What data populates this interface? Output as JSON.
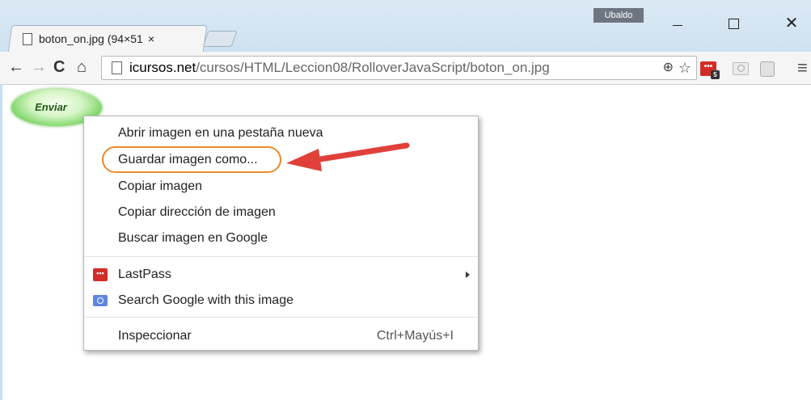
{
  "window": {
    "profile_name": "Ubaldo",
    "close_glyph": "✕"
  },
  "tab": {
    "title": "boton_on.jpg (94×51",
    "close_glyph": "×"
  },
  "toolbar": {
    "back_glyph": "←",
    "forward_glyph": "→",
    "reload_glyph": "C",
    "home_glyph": "⌂",
    "url_domain": "icursos.net",
    "url_path": "/cursos/HTML/Leccion08/RolloverJavaScript/boton_on.jpg",
    "zoom_glyph": "⊕",
    "star_glyph": "☆",
    "lastpass_glyph": "•••",
    "lastpass_count": "5",
    "menu_glyph": "≡"
  },
  "page": {
    "image_button_text": "Enviar"
  },
  "context_menu": {
    "items": [
      {
        "label": "Abrir imagen en una pestaña nueva"
      },
      {
        "label": "Guardar imagen como..."
      },
      {
        "label": "Copiar imagen"
      },
      {
        "label": "Copiar dirección de imagen"
      },
      {
        "label": "Buscar imagen en Google"
      },
      {
        "label": "LastPass",
        "icon": "lastpass-icon",
        "icon_text": "•••",
        "has_submenu": true
      },
      {
        "label": "Search Google with this image",
        "icon": "camera-icon"
      },
      {
        "label": "Inspeccionar",
        "shortcut": "Ctrl+Mayús+I"
      }
    ]
  },
  "annotation": {
    "highlight_color": "#e88a2a",
    "arrow_color": "#e0403a"
  }
}
